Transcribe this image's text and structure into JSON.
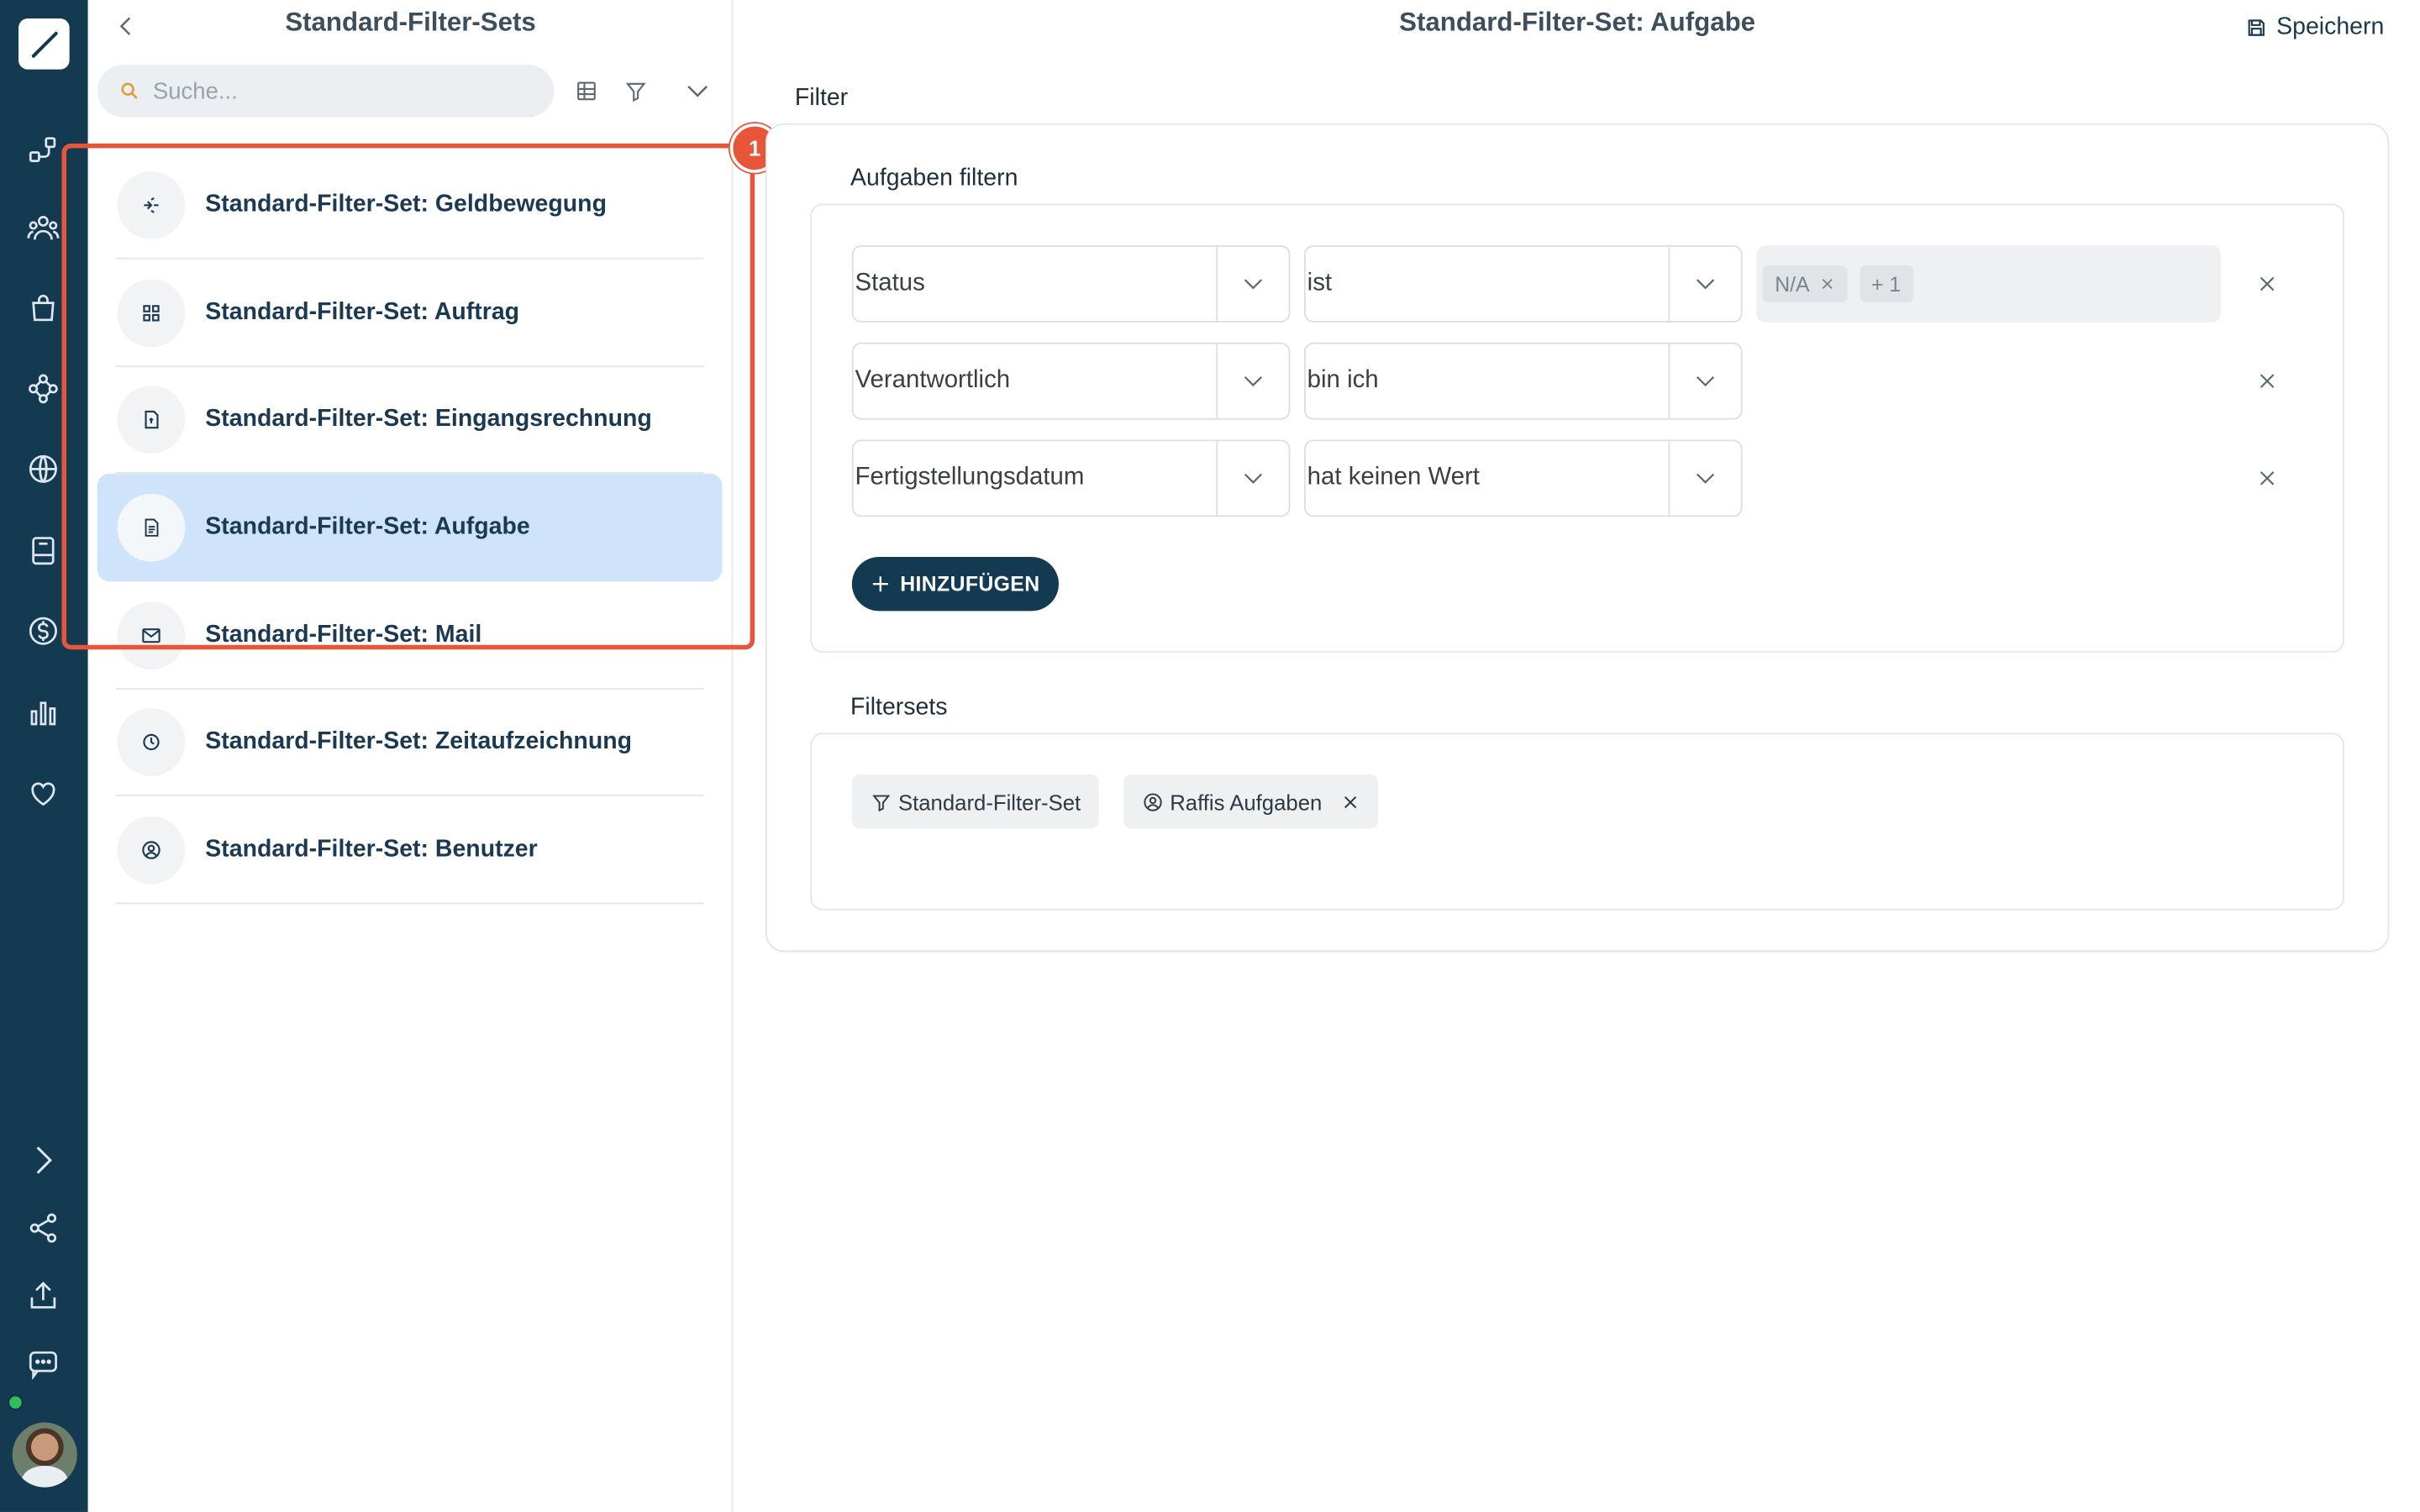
{
  "list_panel": {
    "title": "Standard-Filter-Sets",
    "search_placeholder": "Suche...",
    "items": [
      {
        "label": "Standard-Filter-Set: Geldbewegung",
        "icon": "money-transfer-icon"
      },
      {
        "label": "Standard-Filter-Set: Auftrag",
        "icon": "grid-icon"
      },
      {
        "label": "Standard-Filter-Set: Eingangsrechnung",
        "icon": "invoice-icon"
      },
      {
        "label": "Standard-Filter-Set: Aufgabe",
        "icon": "task-document-icon",
        "active": true
      },
      {
        "label": "Standard-Filter-Set: Mail",
        "icon": "mail-icon"
      },
      {
        "label": "Standard-Filter-Set: Zeitaufzeichnung",
        "icon": "clock-icon"
      },
      {
        "label": "Standard-Filter-Set: Benutzer",
        "icon": "user-circle-icon"
      }
    ]
  },
  "annotation": {
    "badge": "1",
    "color": "#e8563a"
  },
  "main": {
    "title": "Standard-Filter-Set: Aufgabe",
    "save_label": "Speichern",
    "filter_label": "Filter",
    "filter_section_label": "Aufgaben filtern",
    "filters": [
      {
        "field": "Status",
        "operator": "ist",
        "chips": [
          "N/A",
          "+ 1"
        ]
      },
      {
        "field": "Verantwortlich",
        "operator": "bin ich"
      },
      {
        "field": "Fertigstellungsdatum",
        "operator": "hat keinen Wert"
      }
    ],
    "add_label": "HINZUFÜGEN",
    "filtersets_label": "Filtersets",
    "filtersets": [
      {
        "label": "Standard-Filter-Set",
        "icon": "filter-icon"
      },
      {
        "label": "Raffis Aufgaben",
        "icon": "user-circle-icon",
        "removable": true
      }
    ]
  },
  "colors": {
    "rail": "#143a52",
    "active_item": "#cfe4fb",
    "primary_button": "#143a52",
    "annotation": "#e8563a"
  }
}
